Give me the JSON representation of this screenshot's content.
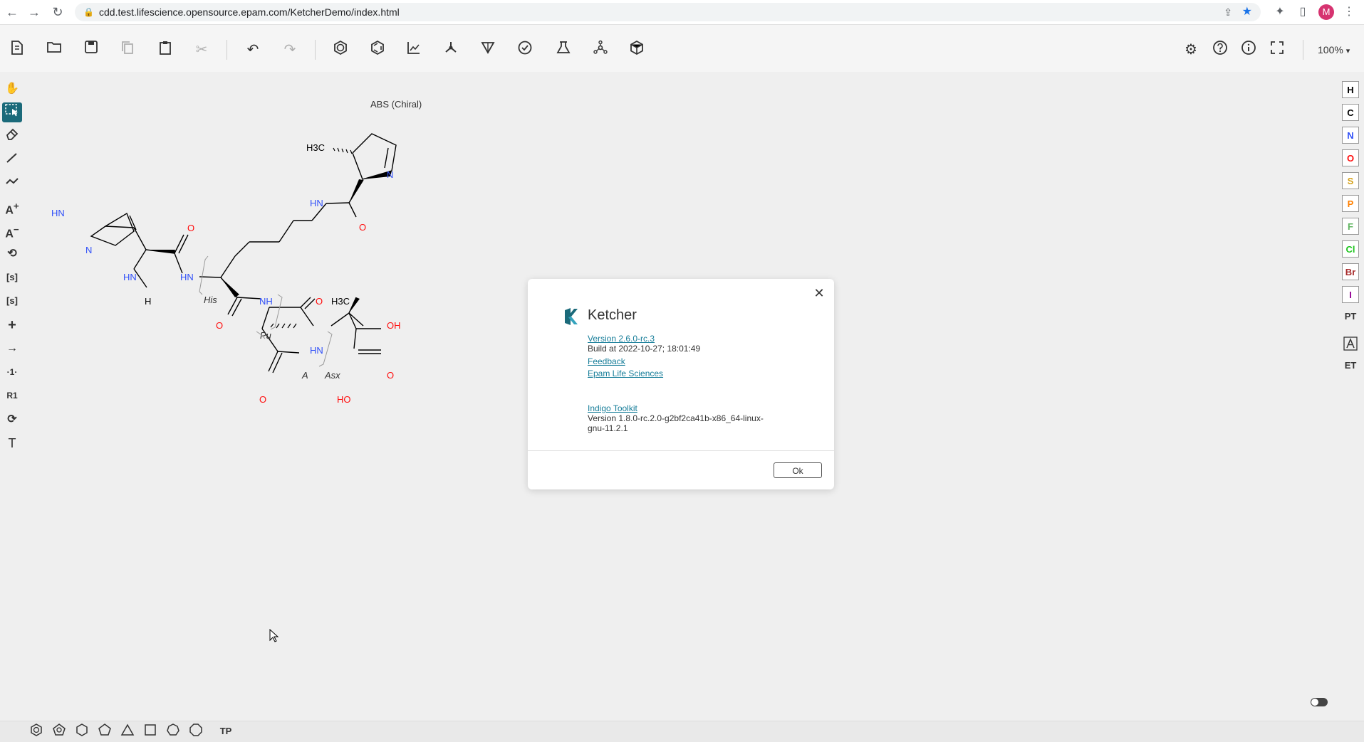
{
  "browser": {
    "url": "cdd.test.lifescience.opensource.epam.com/KetcherDemo/index.html",
    "avatar_letter": "M",
    "icons": [
      "back-arrow-icon",
      "forward-arrow-icon",
      "reload-icon",
      "lock-icon",
      "share-icon",
      "bookmark-star-icon",
      "extensions-icon",
      "sidebar-icon",
      "menu-dots-icon"
    ]
  },
  "toolbar": {
    "zoom": "100%",
    "icons": [
      "new-file-icon",
      "open-icon",
      "save-icon",
      "copy-icon",
      "paste-icon",
      "cut-icon",
      "undo-icon",
      "redo-icon",
      "aromatize-icon",
      "dearomatize-icon",
      "layout-icon",
      "clean-icon",
      "check-icon",
      "analyse-icon",
      "miew-icon",
      "3d-view-icon",
      "settings-icon",
      "help-icon",
      "about-icon",
      "fullscreen-icon"
    ]
  },
  "left_tools": {
    "atom_labels": {
      "add": "A",
      "remove": "A",
      "sgroup": "[s]",
      "data_sgroup": "[s]",
      "rgroup": "R1",
      "text": "T"
    },
    "icons": [
      "hand-icon",
      "select-lasso-icon",
      "eraser-icon",
      "bond-icon",
      "chain-icon",
      "charge-plus-icon",
      "charge-minus-icon",
      "rotate-icon",
      "sgroup-icon",
      "data-sgroup-icon",
      "plus-icon",
      "reaction-arrow-icon",
      "reaction-mapping-icon",
      "rgroup-icon",
      "reaction-cycle-icon",
      "text-tool-icon"
    ]
  },
  "atoms": [
    {
      "symbol": "H",
      "color": "#000000"
    },
    {
      "symbol": "C",
      "color": "#000000"
    },
    {
      "symbol": "N",
      "color": "#3050F8"
    },
    {
      "symbol": "O",
      "color": "#FF0D0D"
    },
    {
      "symbol": "S",
      "color": "#D4A019"
    },
    {
      "symbol": "P",
      "color": "#FF8000"
    },
    {
      "symbol": "F",
      "color": "#5FB45F"
    },
    {
      "symbol": "Cl",
      "color": "#1FC41F"
    },
    {
      "symbol": "Br",
      "color": "#A62929"
    },
    {
      "symbol": "I",
      "color": "#940094"
    }
  ],
  "atom_extras": {
    "periodic_table": "PT",
    "extended": "ET"
  },
  "canvas": {
    "chiral_label": "ABS (Chiral)",
    "labels": {
      "h3c_top": "H3C",
      "n_ring": "N",
      "hn_amide_top": "HN",
      "o_amide_top": "O",
      "hn_imid": "HN",
      "n_imid": "N",
      "o_his": "O",
      "hn_his_amine": "HN",
      "h_his": "H",
      "hn_his": "HN",
      "his": "His",
      "o_lys": "O",
      "nh_lys": "NH",
      "o_asx": "O",
      "h3c_thr": "H3C",
      "oh_thr": "OH",
      "hn_thr": "HN",
      "pu": "Pu",
      "a": "A",
      "asx": "Asx",
      "o_side": "O",
      "o_cooh": "O",
      "ho_cooh": "HO"
    }
  },
  "dialog": {
    "title": "Ketcher",
    "version_link": "Version 2.6.0-rc.3",
    "build": "Build at 2022-10-27; 18:01:49",
    "feedback": "Feedback",
    "epam": "Epam Life Sciences",
    "indigo": "Indigo Toolkit",
    "indigo_version": "Version 1.8.0-rc.2.0-g2bf2ca41b-x86_64-linux-gnu-11.2.1",
    "ok": "Ok",
    "brand_color": "#167d99"
  },
  "templates": {
    "label_tp": "TP",
    "icons": [
      "benzene-icon",
      "pentagon-icon",
      "cyclohexane-icon",
      "cyclopentane-icon",
      "cyclopropane-icon",
      "cyclobutane-icon",
      "cycloheptane-icon",
      "cyclooctane-icon",
      "template-library-icon"
    ]
  }
}
